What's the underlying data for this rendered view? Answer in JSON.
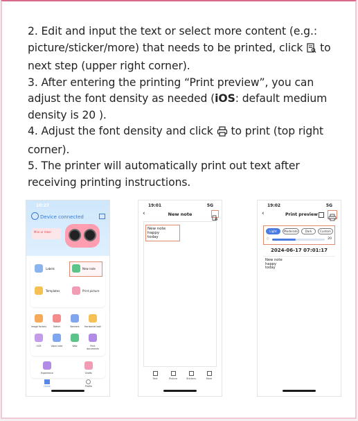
{
  "instructions": {
    "step2_a": "2. Edit and input the text or select more content (e.g.: picture/sticker/more) that needs to be printed, click",
    "step2_b": "to next step (upper right corner).",
    "step3_a": "3. After entering the printing “Print preview”, you can adjust the font density as needed (",
    "step3_ios": "iOS",
    "step3_b": ":  default medium density is 20 ).",
    "step4_a": "4. Adjust the font density and click",
    "step4_b": "to print (top right corner).",
    "step5": "5. The printer will automatically print out text after receiving printing instructions."
  },
  "phone1": {
    "time": "10:27",
    "title": "Device connected",
    "subtitle": "",
    "mini_label": "Mini ar lnber",
    "cards": {
      "labels": "Labels",
      "new_note": "New note",
      "templates": "Templates",
      "print_picture": "Print picture"
    },
    "grid": [
      "Image factory",
      "Sketch",
      "Banners",
      "Horizontal look",
      "OCR",
      "Voice note",
      "Web",
      "Print documents"
    ],
    "bottom": [
      "Experience",
      "Drafts"
    ],
    "nav": [
      "Home",
      "Profile"
    ]
  },
  "phone2": {
    "time": "19:01",
    "signal": "5G",
    "title": "New note",
    "lines": [
      "New note",
      "happy",
      "today"
    ],
    "tools": [
      "Text",
      "Picture",
      "Stickers",
      "More"
    ]
  },
  "phone3": {
    "time": "19:02",
    "signal": "5G",
    "title": "Print preview",
    "options": [
      "Light",
      "Moderate",
      "Dark",
      "Custom"
    ],
    "density": "20",
    "density_fraction": 0.45,
    "timestamp": "2024-06-17 07:01:17",
    "lines": [
      "New note",
      "happy",
      "today"
    ]
  },
  "colors": {
    "accent": "#d86a8c",
    "highlight": "#e28a6f",
    "blue": "#4a7be0"
  }
}
